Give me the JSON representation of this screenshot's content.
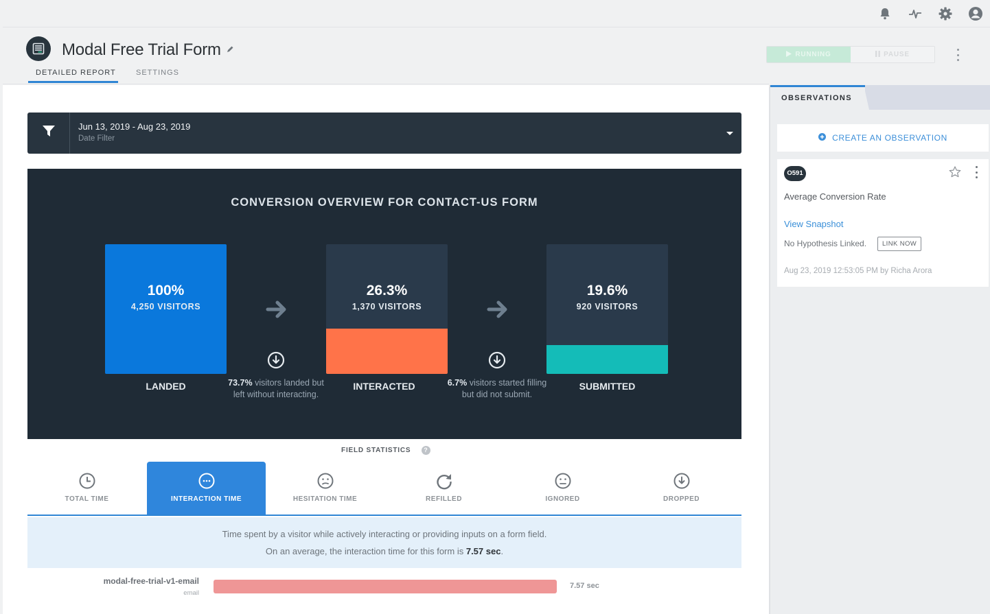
{
  "topbar": {
    "icons": [
      "bell-icon",
      "activity-icon",
      "gear-icon",
      "user-icon"
    ]
  },
  "header": {
    "title": "Modal Free Trial Form",
    "tabs": [
      {
        "label": "DETAILED REPORT",
        "active": true
      },
      {
        "label": "SETTINGS",
        "active": false
      }
    ],
    "running_label": "RUNNING",
    "pause_label": "PAUSE"
  },
  "date_filter": {
    "range": "Jun 13, 2019 - Aug 23, 2019",
    "label": "Date Filter"
  },
  "overview": {
    "title": "CONVERSION OVERVIEW FOR CONTACT-US FORM",
    "stages": [
      {
        "label": "LANDED",
        "percent": "100%",
        "visitors": "4,250 VISITORS",
        "fill_fraction": 1.0,
        "color": "#0a78dc"
      },
      {
        "label": "INTERACTED",
        "percent": "26.3%",
        "visitors": "1,370 VISITORS",
        "fill_fraction": 0.35,
        "color": "#ff7349"
      },
      {
        "label": "SUBMITTED",
        "percent": "19.6%",
        "visitors": "920 VISITORS",
        "fill_fraction": 0.22,
        "color": "#14bcb8"
      }
    ],
    "dropoffs": [
      {
        "percent": "73.7%",
        "text": "visitors landed but left without interacting."
      },
      {
        "percent": "6.7%",
        "text": "visitors started filling but did not submit."
      }
    ]
  },
  "field_statistics": {
    "title": "FIELD STATISTICS",
    "help": "?",
    "tabs": [
      {
        "label": "TOTAL TIME",
        "icon": "clock-icon",
        "active": false
      },
      {
        "label": "INTERACTION TIME",
        "icon": "chat-dots-icon",
        "active": true
      },
      {
        "label": "HESITATION TIME",
        "icon": "confused-face-icon",
        "active": false
      },
      {
        "label": "REFILLED",
        "icon": "refresh-icon",
        "active": false
      },
      {
        "label": "IGNORED",
        "icon": "neutral-face-icon",
        "active": false
      },
      {
        "label": "DROPPED",
        "icon": "download-circle-icon",
        "active": false
      }
    ],
    "description": "Time spent by a visitor while actively interacting or providing inputs on a form field.",
    "average_prefix": "On an average, the interaction time for this form is",
    "average_value": "7.57 sec",
    "average_suffix": ".",
    "fields": [
      {
        "name": "modal-free-trial-v1-email",
        "type": "email",
        "value": "7.57 sec",
        "fraction": 0.714
      }
    ]
  },
  "observations": {
    "tab_label": "OBSERVATIONS",
    "create_label": "CREATE AN OBSERVATION",
    "items": [
      {
        "id": "O591",
        "name": "Average Conversion Rate",
        "link": "View Snapshot",
        "hypothesis": "No Hypothesis Linked.",
        "link_now": "LINK NOW",
        "meta": "Aug 23, 2019 12:53:05 PM by Richa Arora"
      }
    ]
  }
}
